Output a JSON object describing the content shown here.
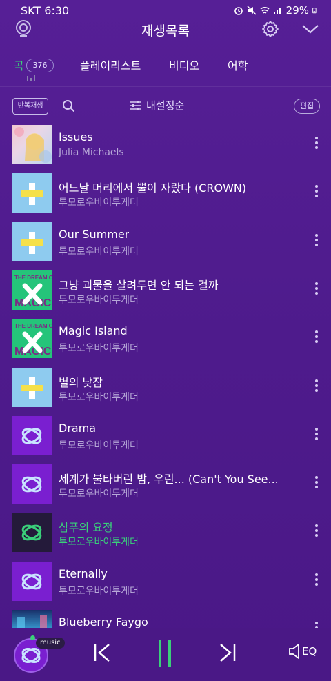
{
  "status": {
    "carrier": "SKT 6:30",
    "battery": "29%"
  },
  "header": {
    "title": "재생목록"
  },
  "tabs": [
    {
      "label": "곡",
      "count": "376"
    },
    {
      "label": "플레이리스트"
    },
    {
      "label": "비디오"
    },
    {
      "label": "어학"
    }
  ],
  "toolbar": {
    "repeat_label": "반복재생",
    "sort_label": "내설정순",
    "edit_label": "편집"
  },
  "songs": [
    {
      "title": "Issues",
      "artist": "Julia Michaels",
      "art": "issues"
    },
    {
      "title": "어느날 머리에서 뿔이 자랐다 (CROWN)",
      "artist": "투모로우바이투게더",
      "art": "blue"
    },
    {
      "title": "Our Summer",
      "artist": "투모로우바이투게더",
      "art": "blue"
    },
    {
      "title": "그냥 괴물을 살려두면 안 되는 걸까",
      "artist": "투모로우바이투게더",
      "art": "green"
    },
    {
      "title": "Magic Island",
      "artist": "투모로우바이투게더",
      "art": "green"
    },
    {
      "title": "별의 낮잠",
      "artist": "투모로우바이투게더",
      "art": "blue"
    },
    {
      "title": "Drama",
      "artist": "투모로우바이투게더",
      "art": "purple"
    },
    {
      "title": "세계가 불타버린 밤, 우린... (Can't You See...",
      "artist": "투모로우바이투게더",
      "art": "purple"
    },
    {
      "title": "샴푸의 요정",
      "artist": "투모로우바이투게더",
      "art": "dark",
      "playing": true
    },
    {
      "title": "Eternally",
      "artist": "투모로우바이투게더",
      "art": "purple"
    },
    {
      "title": "Blueberry Faygo",
      "artist": "",
      "art": "blueberry"
    }
  ],
  "album_art_text": {
    "dream_chapter": "THE DREAM CHAPTER",
    "magic": "MAGIC"
  },
  "player": {
    "tag": "music",
    "eq_label": "EQ",
    "state": "playing"
  },
  "colors": {
    "accent": "#3ad07a",
    "background": "#561f96",
    "subtext": "#b7a8d8"
  }
}
